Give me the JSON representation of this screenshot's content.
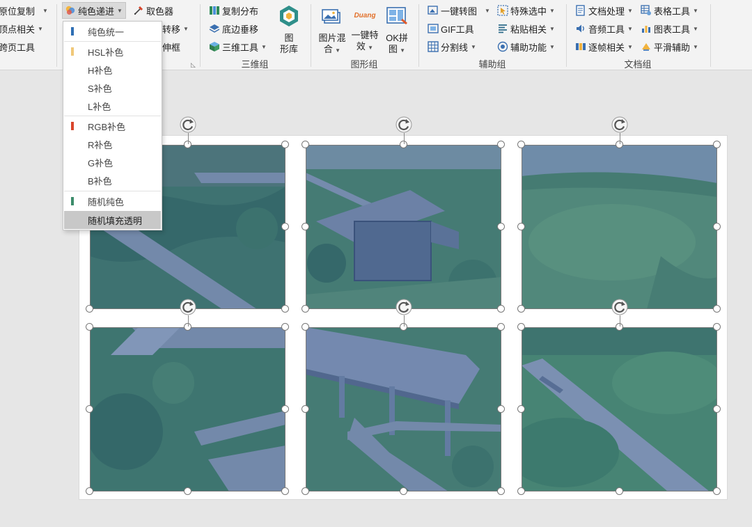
{
  "ribbon": {
    "col0": {
      "top": "原位复制",
      "mid": "顶点相关",
      "bot": "跨页工具"
    },
    "color_dropdown": {
      "label": "纯色递进"
    },
    "eyedropper": {
      "label": "取色器"
    },
    "partial": {
      "mid": "转移",
      "bot": "伸框"
    },
    "group3d": {
      "copy_distribute": "复制分布",
      "bottom_vertical": "底边垂移",
      "tools_3d": "三维工具",
      "graphics_lib": "图\n形库",
      "label": "三维组"
    },
    "graphics": {
      "image_mix": "图片混\n合",
      "one_click_effect": "一键特\n效",
      "ok_collage": "OK拼\n图",
      "duang": "Duang",
      "label": "图形组"
    },
    "aux": {
      "convert_image": "一键转图",
      "gif_tools": "GIF工具",
      "split_lines": "分割线",
      "special_select": "特殊选中",
      "paste": "粘贴相关",
      "aux_funcs": "辅助功能",
      "label": "辅助组"
    },
    "doc": {
      "doc_process": "文档处理",
      "audio": "音频工具",
      "frame": "逐帧相关",
      "table": "表格工具",
      "chart": "图表工具",
      "smooth": "平滑辅助",
      "label": "文档组"
    }
  },
  "dropdown": {
    "items": [
      {
        "label": "纯色统一",
        "color": "#2f6fb4"
      },
      {
        "label": "HSL补色",
        "color": "#f0c879"
      },
      {
        "label": "H补色",
        "color": ""
      },
      {
        "label": "S补色",
        "color": ""
      },
      {
        "label": "L补色",
        "color": ""
      },
      {
        "label": "RGB补色",
        "color": "#d9452c"
      },
      {
        "label": "R补色",
        "color": ""
      },
      {
        "label": "G补色",
        "color": ""
      },
      {
        "label": "B补色",
        "color": ""
      },
      {
        "label": "随机纯色",
        "color": "#3d8c6b"
      },
      {
        "label": "随机填充透明",
        "color": ""
      }
    ],
    "highlighted": "随机填充透明"
  },
  "slide": {
    "overlay_color": "#3e66be",
    "tiles": [
      "boardwalk-left",
      "pavilion",
      "grass-field",
      "stairs-bridge",
      "bridge-pillars",
      "path-grass"
    ]
  },
  "colors": {
    "ribbon_bg": "#f3f3f3",
    "canvas_bg": "#e6e6e6",
    "highlight": "#c8c8c8"
  }
}
